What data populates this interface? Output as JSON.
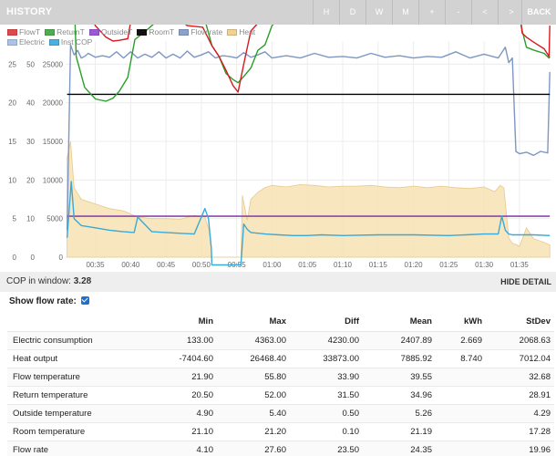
{
  "header": {
    "title": "HISTORY",
    "buttons": [
      "H",
      "D",
      "W",
      "M",
      "+",
      "-",
      "<",
      ">",
      "BACK"
    ]
  },
  "legend": [
    {
      "label": "FlowT",
      "color": "#e0484a"
    },
    {
      "label": "ReturnT",
      "color": "#4cae4c"
    },
    {
      "label": "OutsideT",
      "color": "#9b59d6"
    },
    {
      "label": "RoomT",
      "color": "#111111"
    },
    {
      "label": "Flow rate",
      "color": "#8aa3c8"
    },
    {
      "label": "Heat",
      "color": "#f3d18f"
    },
    {
      "label": "Electric",
      "color": "#a9c4e8"
    },
    {
      "label": "Inst COP",
      "color": "#4ab0e0"
    }
  ],
  "chart_data": {
    "type": "line",
    "x_ticks": [
      "00:35",
      "00:40",
      "00:45",
      "00:50",
      "00:55",
      "01:00",
      "01:05",
      "01:10",
      "01:15",
      "01:20",
      "01:25",
      "01:30",
      "01:35"
    ],
    "y_left_ticks": [
      "0",
      "5",
      "10",
      "15",
      "20",
      "25"
    ],
    "y_mid_ticks": [
      "0",
      "10",
      "20",
      "30",
      "40",
      "50"
    ],
    "y_right_ticks": [
      "0",
      "5000",
      "10000",
      "15000",
      "20000",
      "25000"
    ],
    "series": [
      {
        "name": "FlowT",
        "color": "#d7191c",
        "x": [
          31.0,
          31.7,
          32.3,
          33.5,
          35,
          36.5,
          37.5,
          38.4,
          39.6,
          40.6,
          42,
          44,
          46,
          48,
          50.2,
          51.5,
          52.5,
          53.5,
          54.5,
          55.2,
          56,
          57,
          58,
          59,
          60,
          62,
          64,
          66,
          70,
          75,
          80,
          85,
          90,
          92.5,
          93.3,
          93.8,
          94.5,
          95.4,
          96,
          97.1,
          98.5,
          99.2,
          99.3
        ],
        "y": [
          45,
          50,
          41,
          33,
          30,
          28.5,
          28,
          28.1,
          28.3,
          33.8,
          33,
          31.8,
          31.5,
          30,
          29.8,
          27.4,
          26,
          24.2,
          22.2,
          21.4,
          25,
          29.3,
          30.3,
          32,
          34,
          35.4,
          36.5,
          37.8,
          40.5,
          43.7,
          46.5,
          49.6,
          52.5,
          54.5,
          55.6,
          53,
          35,
          29,
          28.5,
          27.8,
          27,
          26,
          30
        ]
      },
      {
        "name": "ReturnT",
        "color": "#2a9d2a",
        "x": [
          31.0,
          31.7,
          32.3,
          33.5,
          35,
          36.5,
          37.5,
          38.4,
          39.6,
          40.6,
          42,
          44,
          46,
          48,
          50.2,
          51.5,
          52.5,
          53.5,
          54.5,
          55.2,
          56,
          57,
          58,
          59,
          60,
          62,
          64,
          66,
          70,
          75,
          80,
          85,
          90,
          92.5,
          93.3,
          93.8,
          94.5,
          95.4,
          96,
          97.1,
          98.5,
          99.2,
          99.3
        ],
        "y": [
          40,
          42,
          26,
          22,
          20.5,
          20.2,
          20.6,
          21.5,
          23.3,
          28.2,
          29.2,
          30.8,
          31.8,
          32.2,
          31.8,
          27.4,
          26,
          23.8,
          23,
          22.6,
          23.4,
          24.5,
          26.8,
          27.5,
          30,
          31.8,
          32.8,
          34,
          36.5,
          39.5,
          42.5,
          45.6,
          48.7,
          50.4,
          51.8,
          50.9,
          34,
          29.3,
          27.2,
          26.8,
          26.4,
          25.8,
          26
        ]
      },
      {
        "name": "RoomT",
        "color": "#000000",
        "x": [
          31,
          99.3
        ],
        "y": [
          21.1,
          21.1
        ]
      },
      {
        "name": "OutsideT",
        "color": "#8e44ad",
        "x": [
          31,
          99.3
        ],
        "y": [
          5.3,
          5.3
        ]
      },
      {
        "name": "Flow rate",
        "color": "#7d97c2",
        "x": [
          31,
          31.5,
          32,
          32.5,
          33,
          33.5,
          34,
          35,
          36,
          37,
          38,
          39,
          40,
          41,
          42,
          43,
          44,
          45,
          46,
          47,
          48,
          49,
          50,
          51,
          52,
          53,
          54,
          55,
          56,
          57,
          58,
          59,
          60,
          62,
          64,
          66,
          68,
          70,
          72,
          74,
          76,
          78,
          80,
          82,
          84,
          86,
          88,
          90,
          92,
          93,
          93.5,
          94,
          94.5,
          95,
          96,
          97,
          98,
          99,
          99.3
        ],
        "y": [
          3.5,
          27.5,
          26.2,
          26.8,
          25.8,
          26,
          26.4,
          25.9,
          26.1,
          25.9,
          26.6,
          25.8,
          26.6,
          25.8,
          26.3,
          25.9,
          26.6,
          25.8,
          26.3,
          25.8,
          26.7,
          25.9,
          26.2,
          26.6,
          25.8,
          26.1,
          26,
          25.8,
          26.5,
          25.9,
          26.2,
          26.6,
          25.8,
          26.1,
          25.8,
          26.4,
          25.9,
          26,
          25.8,
          26.4,
          25.9,
          26.1,
          25.8,
          26,
          25.9,
          26.6,
          25.8,
          26.3,
          25.8,
          27.2,
          25.2,
          25.8,
          13.7,
          13.4,
          13.6,
          13.2,
          13.7,
          13.5,
          24
        ]
      },
      {
        "name": "Inst COP",
        "color": "#3aa9d8",
        "x": [
          31,
          31.6,
          32,
          33,
          35,
          37,
          39,
          40.5,
          41,
          43,
          45,
          47,
          49,
          50.5,
          51,
          51.4,
          51.5,
          55.6,
          56,
          56.5,
          57,
          59,
          61,
          63,
          65,
          67,
          70,
          75,
          80,
          85,
          90,
          92,
          92.5,
          93,
          93.5,
          94,
          95,
          97,
          99.3
        ],
        "y": [
          2.5,
          9.8,
          5,
          4.1,
          3.8,
          3.5,
          3.3,
          3.2,
          5.2,
          3.3,
          3.2,
          3.1,
          3.0,
          6.3,
          5,
          1.2,
          -2,
          -2,
          4.3,
          3.6,
          3.2,
          3.0,
          2.9,
          2.8,
          2.8,
          2.9,
          2.8,
          2.9,
          2.9,
          2.8,
          3.0,
          3.0,
          5.3,
          3.5,
          3.0,
          2.9,
          2.9,
          2.9,
          2.8
        ]
      },
      {
        "name": "Heat",
        "color": "#f3d18f",
        "x": [
          31,
          31.5,
          32,
          33,
          35,
          37,
          39,
          41,
          43,
          45,
          47,
          49,
          50.5,
          51.2,
          51.5,
          55.6,
          55.8,
          56.5,
          57,
          58,
          59,
          60,
          62,
          64,
          66,
          68,
          70,
          72,
          74,
          76,
          78,
          80,
          82,
          84,
          86,
          88,
          90,
          91.5,
          92.3,
          92.8,
          93.5,
          94,
          94.6,
          95,
          96,
          97,
          98.5,
          99.3
        ],
        "y": [
          12.9,
          15,
          9,
          7.5,
          6.9,
          6.3,
          6,
          5.2,
          5.0,
          5.0,
          4.9,
          5.4,
          5.2,
          3.2,
          0,
          0,
          8,
          4.8,
          7.5,
          8.4,
          9.0,
          9.3,
          9.1,
          9.4,
          9.3,
          9.1,
          9.2,
          9.2,
          9.3,
          9.1,
          9.0,
          9.2,
          9.0,
          9.2,
          9.0,
          8.9,
          9.1,
          8.5,
          9.3,
          9.0,
          2.5,
          1.8,
          1.6,
          1.4,
          3.8,
          2.4,
          1.9,
          1.6
        ]
      }
    ],
    "ylim": [
      0,
      28
    ]
  },
  "cop": {
    "label": "COP in window:",
    "value": "3.28",
    "hide_label": "HIDE DETAIL"
  },
  "flow_option": {
    "label": "Show flow rate:",
    "checked": true
  },
  "table": {
    "headers": [
      "",
      "Min",
      "Max",
      "Diff",
      "Mean",
      "kWh",
      "StDev"
    ],
    "rows": [
      [
        "Electric consumption",
        "133.00",
        "4363.00",
        "4230.00",
        "2407.89",
        "2.669",
        "2068.63"
      ],
      [
        "Heat output",
        "-7404.60",
        "26468.40",
        "33873.00",
        "7885.92",
        "8.740",
        "7012.04"
      ],
      [
        "Flow temperature",
        "21.90",
        "55.80",
        "33.90",
        "39.55",
        "",
        "32.68"
      ],
      [
        "Return temperature",
        "20.50",
        "52.00",
        "31.50",
        "34.96",
        "",
        "28.91"
      ],
      [
        "Outside temperature",
        "4.90",
        "5.40",
        "0.50",
        "5.26",
        "",
        "4.29"
      ],
      [
        "Room temperature",
        "21.10",
        "21.20",
        "0.10",
        "21.19",
        "",
        "17.28"
      ],
      [
        "Flow rate",
        "4.10",
        "27.60",
        "23.50",
        "24.35",
        "",
        "19.96"
      ]
    ]
  }
}
